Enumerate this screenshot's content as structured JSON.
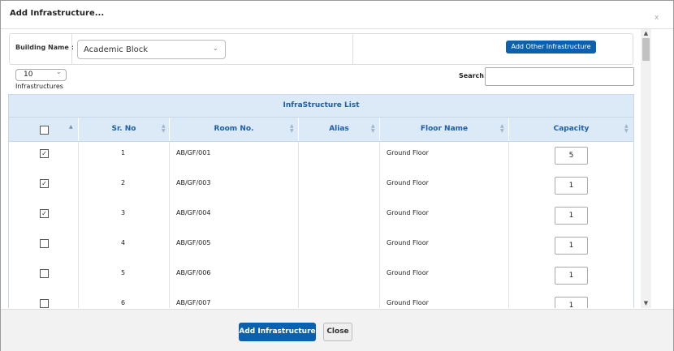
{
  "dialog": {
    "title": "Add Infrastructure...",
    "close_glyph": "x"
  },
  "building": {
    "label": "Building Name :",
    "selected": "Academic Block",
    "add_other_label": "Add Other Infrastructure"
  },
  "list_controls": {
    "length_value": "10",
    "length_label": "Infrastructures",
    "search_label": "Search:",
    "search_value": ""
  },
  "table": {
    "caption": "InfraStructure List",
    "headers": {
      "sr_no": "Sr. No",
      "room_no": "Room No.",
      "alias": "Alias",
      "floor_name": "Floor Name",
      "capacity": "Capacity"
    },
    "rows": [
      {
        "checked": true,
        "sr_no": "1",
        "room_no": "AB/GF/001",
        "alias": "",
        "floor_name": "Ground Floor",
        "capacity": "5"
      },
      {
        "checked": true,
        "sr_no": "2",
        "room_no": "AB/GF/003",
        "alias": "",
        "floor_name": "Ground Floor",
        "capacity": "1"
      },
      {
        "checked": true,
        "sr_no": "3",
        "room_no": "AB/GF/004",
        "alias": "",
        "floor_name": "Ground Floor",
        "capacity": "1"
      },
      {
        "checked": false,
        "sr_no": "4",
        "room_no": "AB/GF/005",
        "alias": "",
        "floor_name": "Ground Floor",
        "capacity": "1"
      },
      {
        "checked": false,
        "sr_no": "5",
        "room_no": "AB/GF/006",
        "alias": "",
        "floor_name": "Ground Floor",
        "capacity": "1"
      },
      {
        "checked": false,
        "sr_no": "6",
        "room_no": "AB/GF/007",
        "alias": "",
        "floor_name": "Ground Floor",
        "capacity": "1"
      }
    ]
  },
  "footer": {
    "add_label": "Add Infrastructure",
    "close_label": "Close"
  },
  "colors": {
    "primary_button": "#0b61ad",
    "table_header_bg": "#dce9f6",
    "table_header_text": "#1d5fa8"
  }
}
